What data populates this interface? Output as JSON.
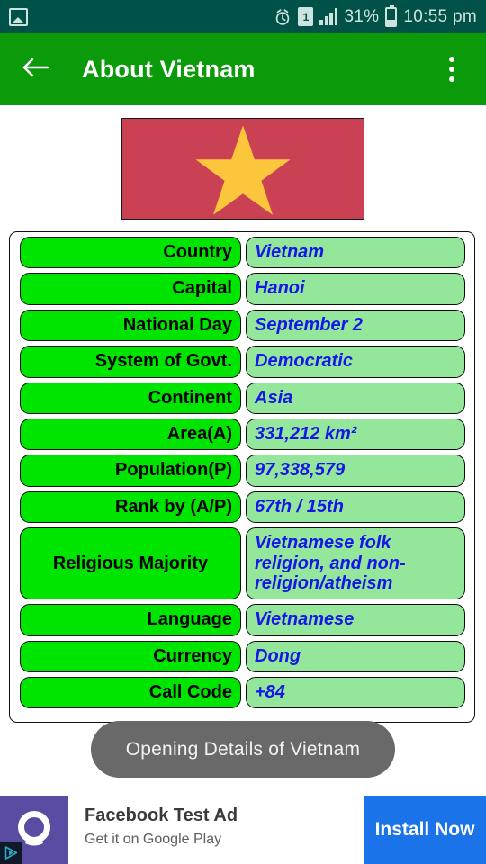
{
  "status_bar": {
    "left_icons": [
      "photo-icon"
    ],
    "alarm_icon": "alarm-icon",
    "sim_label": "1",
    "signal_icon": "signal-bars-icon",
    "battery_percent": "31%",
    "battery_icon": "battery-icon",
    "time": "10:55 pm",
    "background": "#005249"
  },
  "app_bar": {
    "back_icon": "back-arrow-icon",
    "title": "About Vietnam",
    "overflow_icon": "more-vertical-icon",
    "background": "#0a9a0a"
  },
  "flag": {
    "name": "vietnam-flag",
    "field_color": "#cb4154",
    "star_color": "#fcc63c"
  },
  "info_table": {
    "rows": [
      {
        "label": "Country",
        "value": "Vietnam"
      },
      {
        "label": "Capital",
        "value": "Hanoi"
      },
      {
        "label": "National Day",
        "value": "September 2"
      },
      {
        "label": "System of Govt.",
        "value": "Democratic"
      },
      {
        "label": "Continent",
        "value": "Asia"
      },
      {
        "label": "Area(A)",
        "value": "331,212 km²"
      },
      {
        "label": "Population(P)",
        "value": "97,338,579"
      },
      {
        "label": "Rank by (A/P)",
        "value": "67th / 15th"
      },
      {
        "label": "Religious Majority",
        "value": "Vietnamese folk religion, and non-religion/atheism"
      },
      {
        "label": "Language",
        "value": "Vietnamese"
      },
      {
        "label": "Currency",
        "value": "Dong"
      },
      {
        "label": "Call Code",
        "value": "+84"
      }
    ],
    "label_color": "#00e500",
    "value_color": "#93e69a",
    "value_text_color": "#1616e8"
  },
  "toast": {
    "message": "Opening Details of Vietnam",
    "background": "#696969"
  },
  "ad": {
    "icon": "advertiser-logo-icon",
    "adchoices_icon": "adchoices-icon",
    "title": "Facebook Test Ad",
    "subtitle": "Get it on Google Play",
    "cta_label": "Install Now",
    "cta_color": "#1a73e8"
  }
}
